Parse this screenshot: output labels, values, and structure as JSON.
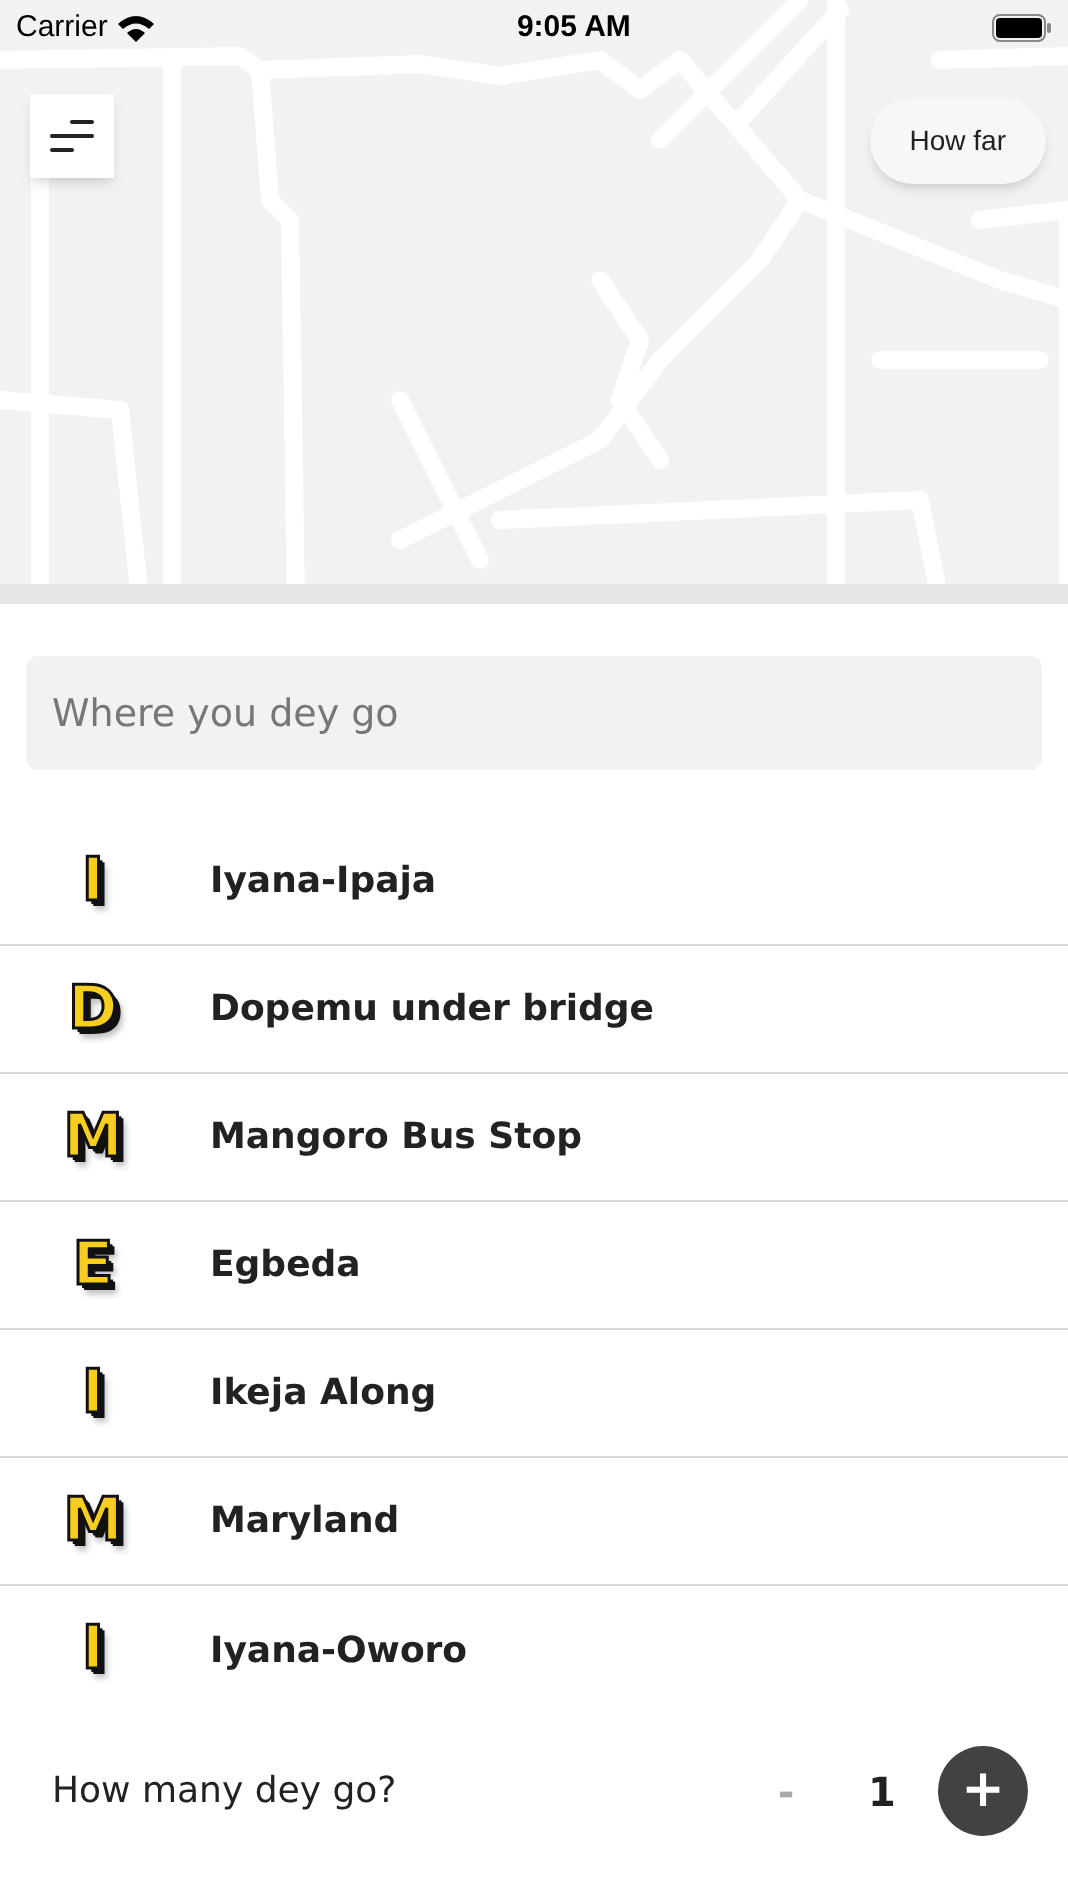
{
  "status_bar": {
    "carrier": "Carrier",
    "time": "9:05 AM"
  },
  "map": {
    "kind": "picture",
    "distance_button": "How far"
  },
  "search": {
    "placeholder": "Where you dey go"
  },
  "places": [
    {
      "letter": "I",
      "name": "Iyana-Ipaja"
    },
    {
      "letter": "D",
      "name": "Dopemu under bridge"
    },
    {
      "letter": "M",
      "name": "Mangoro Bus Stop"
    },
    {
      "letter": "E",
      "name": "Egbeda"
    },
    {
      "letter": "I",
      "name": "Ikeja Along"
    },
    {
      "letter": "M",
      "name": "Maryland"
    },
    {
      "letter": "I",
      "name": "Iyana-Oworo"
    }
  ],
  "passengers": {
    "label": "How many dey go?",
    "decrement": "-",
    "decrement_disabled": true,
    "count": "1",
    "increment": "+"
  }
}
